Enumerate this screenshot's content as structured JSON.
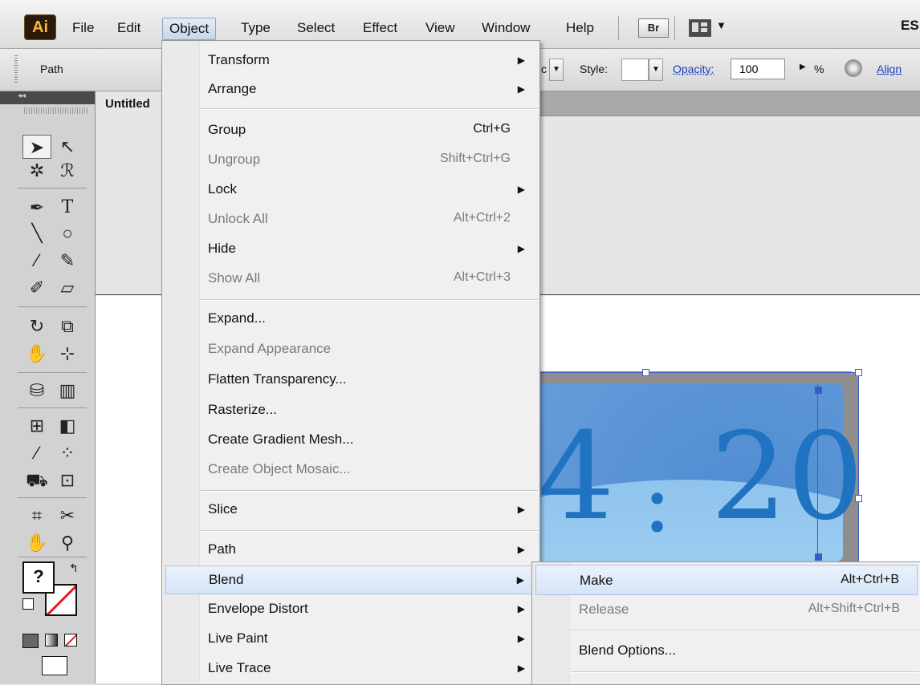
{
  "app": {
    "logo": "Ai"
  },
  "menubar": {
    "items": [
      "File",
      "Edit",
      "Object",
      "Type",
      "Select",
      "Effect",
      "View",
      "Window",
      "Help"
    ],
    "bridge_label": "Br",
    "workspace_label": "ES"
  },
  "controlbar": {
    "selection_type": "Path",
    "style_label": "Style:",
    "brush_fragment": "c",
    "opacity_label": "Opacity:",
    "opacity_value": "100",
    "percent": "%",
    "align_label": "Align"
  },
  "document": {
    "tab_title": "Untitled"
  },
  "artwork": {
    "clock_text": "4",
    "clock_colon": ":",
    "clock_minutes": "20"
  },
  "object_menu": {
    "items": [
      {
        "label": "Transform",
        "shortcut": "",
        "submenu": true,
        "disabled": false
      },
      {
        "label": "Arrange",
        "shortcut": "",
        "submenu": true,
        "disabled": false
      },
      {
        "label": "Group",
        "shortcut": "Ctrl+G",
        "submenu": false,
        "disabled": false
      },
      {
        "label": "Ungroup",
        "shortcut": "Shift+Ctrl+G",
        "submenu": false,
        "disabled": true
      },
      {
        "label": "Lock",
        "shortcut": "",
        "submenu": true,
        "disabled": false
      },
      {
        "label": "Unlock All",
        "shortcut": "Alt+Ctrl+2",
        "submenu": false,
        "disabled": true
      },
      {
        "label": "Hide",
        "shortcut": "",
        "submenu": true,
        "disabled": false
      },
      {
        "label": "Show All",
        "shortcut": "Alt+Ctrl+3",
        "submenu": false,
        "disabled": true
      },
      {
        "label": "Expand...",
        "shortcut": "",
        "submenu": false,
        "disabled": false
      },
      {
        "label": "Expand Appearance",
        "shortcut": "",
        "submenu": false,
        "disabled": true
      },
      {
        "label": "Flatten Transparency...",
        "shortcut": "",
        "submenu": false,
        "disabled": false
      },
      {
        "label": "Rasterize...",
        "shortcut": "",
        "submenu": false,
        "disabled": false
      },
      {
        "label": "Create Gradient Mesh...",
        "shortcut": "",
        "submenu": false,
        "disabled": false
      },
      {
        "label": "Create Object Mosaic...",
        "shortcut": "",
        "submenu": false,
        "disabled": true
      },
      {
        "label": "Slice",
        "shortcut": "",
        "submenu": true,
        "disabled": false
      },
      {
        "label": "Path",
        "shortcut": "",
        "submenu": true,
        "disabled": false
      },
      {
        "label": "Blend",
        "shortcut": "",
        "submenu": true,
        "disabled": false,
        "highlighted": true
      },
      {
        "label": "Envelope Distort",
        "shortcut": "",
        "submenu": true,
        "disabled": false
      },
      {
        "label": "Live Paint",
        "shortcut": "",
        "submenu": true,
        "disabled": false
      },
      {
        "label": "Live Trace",
        "shortcut": "",
        "submenu": true,
        "disabled": false
      }
    ]
  },
  "blend_menu": {
    "items": [
      {
        "label": "Make",
        "shortcut": "Alt+Ctrl+B",
        "disabled": false,
        "highlighted": true
      },
      {
        "label": "Release",
        "shortcut": "Alt+Shift+Ctrl+B",
        "disabled": true
      },
      {
        "label": "Blend Options...",
        "shortcut": "",
        "disabled": false
      }
    ]
  },
  "colors": {
    "menu_highlight": "#d6e5f7",
    "disabled_text": "#7a7a7a",
    "clock_blue": "#1f73c0"
  },
  "icons": {
    "tools": [
      "selection-icon",
      "direct-selection-icon",
      "magic-wand-icon",
      "lasso-icon",
      "pen-icon",
      "type-icon",
      "line-icon",
      "ellipse-icon",
      "paintbrush-icon",
      "pencil-icon",
      "blob-brush-icon",
      "eraser-icon",
      "rotate-icon",
      "scale-icon",
      "warp-icon",
      "free-transform-icon",
      "symbol-sprayer-icon",
      "graph-icon",
      "mesh-icon",
      "gradient-icon",
      "eyedropper-icon",
      "blend-icon",
      "live-paint-bucket-icon",
      "live-paint-selection-icon",
      "crop-area-icon",
      "slice-icon",
      "hand-icon",
      "zoom-icon"
    ]
  }
}
